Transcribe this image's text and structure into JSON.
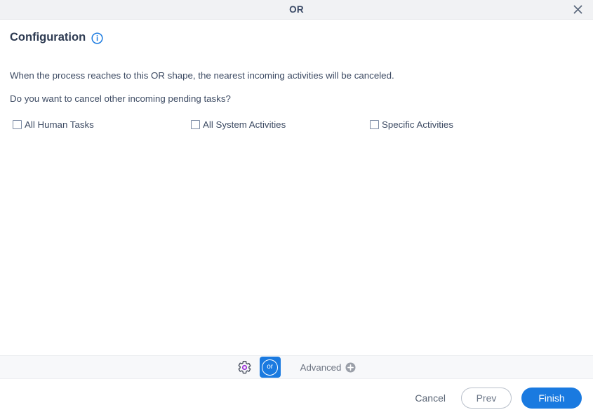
{
  "window": {
    "title": "OR",
    "close_icon": "close-icon"
  },
  "configuration": {
    "heading": "Configuration",
    "info_icon": "info-icon",
    "description_line_1": "When the process reaches to this OR shape, the nearest incoming activities will be canceled.",
    "description_line_2": "Do you want to cancel other incoming pending tasks?",
    "checkboxes": [
      {
        "label": "All Human Tasks",
        "checked": false
      },
      {
        "label": "All System Activities",
        "checked": false
      },
      {
        "label": "Specific Activities",
        "checked": false
      }
    ]
  },
  "toolbar": {
    "settings_icon": "gear-icon",
    "shape_button_label": "or",
    "advanced_label": "Advanced",
    "advanced_icon": "circle-plus-icon"
  },
  "footer": {
    "cancel_label": "Cancel",
    "prev_label": "Prev",
    "finish_label": "Finish"
  },
  "colors": {
    "accent_blue": "#1a7ae0",
    "titlebar_bg": "#f1f2f4",
    "toolbar_bg": "#f7f8fa",
    "text_primary": "#3d4b63",
    "heading": "#2e3b52",
    "gear_accent": "#9b30d9"
  }
}
